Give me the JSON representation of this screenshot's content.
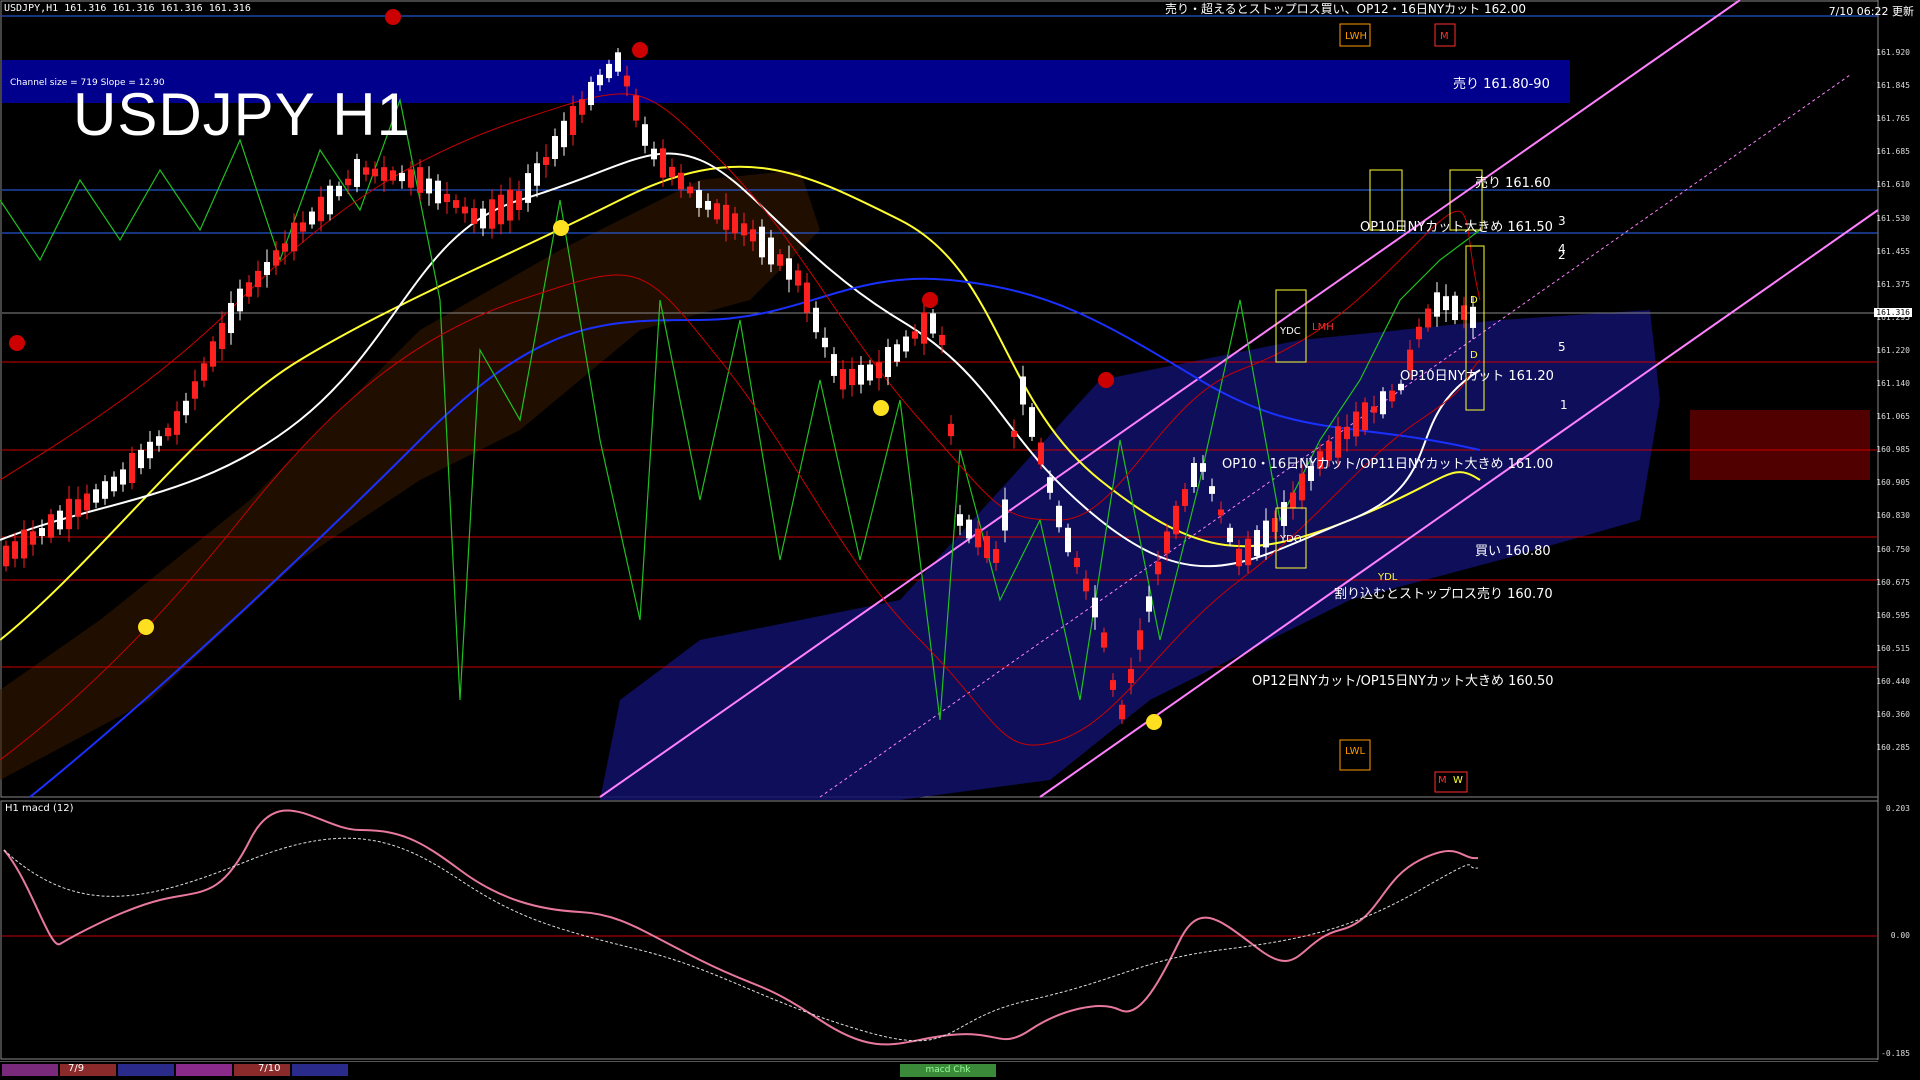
{
  "window": {
    "header": "USDJPY,H1  161.316 161.316 161.316 161.316",
    "datetime": "7/10 06:22 更新",
    "title": "USDJPY H1",
    "channel_info": "Channel size = 719  Slope = 12.90"
  },
  "annotations": {
    "top_note": "売り・超えるとストップロス買い、OP12・16日NYカット 162.00",
    "sell_zone": "売り 161.80-90",
    "sell_161_60": "売り 161.60",
    "op10_161_50": "OP10日NYカット大きめ 161.50",
    "op10_161_20": "OP10日NYカット 161.20",
    "op10_16_161_00": "OP10・16日NYカット/OP11日NYカット大きめ 161.00",
    "buy_160_80": "買い 160.80",
    "stop_sell_160_70": "割り込むとストップロス売り 160.70",
    "op12_15_160_50": "OP12日NYカット/OP15日NYカット大きめ 160.50",
    "box_ydc": "YDC",
    "box_lmh": "LMH",
    "box_ydo": "YDO",
    "box_ydl": "YDL",
    "box_lwh": "LWH",
    "box_lwl": "LWL",
    "box_m_top": "M",
    "box_m_bot": "M",
    "box_w_bot": "W",
    "box_d_top": "D",
    "box_d_bot": "D",
    "num_1": "1",
    "num_2": "2",
    "num_3": "3",
    "num_4": "4",
    "num_5": "5"
  },
  "price_axis": {
    "labels": [
      "161.920",
      "161.845",
      "161.765",
      "161.685",
      "161.610",
      "161.530",
      "161.455",
      "161.375",
      "161.295",
      "161.220",
      "161.140",
      "161.065",
      "160.985",
      "160.905",
      "160.830",
      "160.750",
      "160.675",
      "160.595",
      "160.515",
      "160.440",
      "160.360",
      "160.285"
    ],
    "current_price": "161.316"
  },
  "macd_panel": {
    "label": "H1  macd (12)",
    "axis": [
      "0.203",
      "0.00",
      "-0.185"
    ]
  },
  "bottom": {
    "day1": "7/9",
    "day2": "7/10",
    "tab_label": "macd Chk",
    "colors": [
      "#7a2a7a",
      "#8a2a2a",
      "#2a2a8a",
      "#8a2a8a",
      "#8a2a2a",
      "#2a2a8a"
    ]
  },
  "colors": {
    "bull": "#ffffff",
    "bear": "#ff2020",
    "sma_white": "#ffffff",
    "sma_yellow": "#ffff30",
    "sma_blue": "#1a30ff",
    "channel": "#ff80ff",
    "hline": "#cc0000",
    "sellzone": "#00008c"
  }
}
